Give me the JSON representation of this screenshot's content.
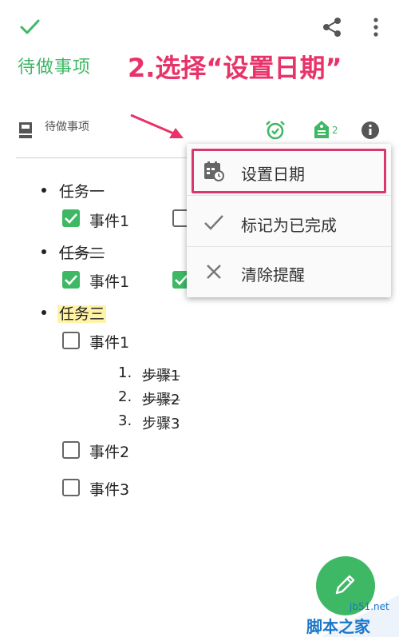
{
  "toolbar": {
    "done_icon": "check-icon",
    "share_icon": "share-icon",
    "more_icon": "more-vert-icon"
  },
  "note_title": "待做事项",
  "annotation": "2.选择“设置日期”",
  "notebook": {
    "name": "待做事项",
    "reminder_icon": "alarm-icon",
    "tag_count": "2",
    "info_icon": "info-icon"
  },
  "content": {
    "task1": {
      "label": "任务一",
      "event1": "事件1",
      "event1_checked": true
    },
    "task2": {
      "label": "任务二",
      "event1": "事件1",
      "event1_checked": true
    },
    "task3": {
      "label": "任务三",
      "event1": "事件1",
      "steps": [
        {
          "num": "1.",
          "label": "步骤1"
        },
        {
          "num": "2.",
          "label": "步骤2"
        },
        {
          "num": "3.",
          "label": "步骤3"
        }
      ],
      "event2": "事件2",
      "event3": "事件3"
    }
  },
  "menu": {
    "items": [
      {
        "label": "设置日期",
        "icon": "calendar-clock-icon"
      },
      {
        "label": "标记为已完成",
        "icon": "check-icon"
      },
      {
        "label": "清除提醒",
        "icon": "close-icon"
      }
    ]
  },
  "fab": {
    "icon": "pencil-icon"
  },
  "watermark": {
    "site": "jb51.net",
    "brand": "脚本之家"
  },
  "colors": {
    "accent": "#3fb865",
    "annotation": "#e8336a",
    "link": "#1a76c9"
  }
}
